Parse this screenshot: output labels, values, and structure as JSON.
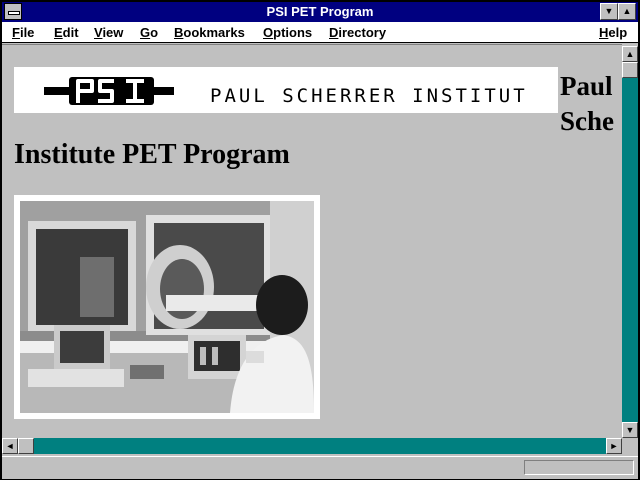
{
  "window": {
    "title": "PSI PET Program",
    "minimize_glyph": "▼",
    "maximize_glyph": "▲"
  },
  "menubar": {
    "items": [
      {
        "label": "File",
        "accel": "F",
        "rest": "ile"
      },
      {
        "label": "Edit",
        "accel": "E",
        "rest": "dit"
      },
      {
        "label": "View",
        "accel": "V",
        "rest": "iew"
      },
      {
        "label": "Go",
        "accel": "G",
        "rest": "o"
      },
      {
        "label": "Bookmarks",
        "accel": "B",
        "rest": "ookmarks"
      },
      {
        "label": "Options",
        "accel": "O",
        "rest": "ptions"
      },
      {
        "label": "Directory",
        "accel": "D",
        "rest": "irectory"
      },
      {
        "label": "Help",
        "accel": "H",
        "rest": "elp"
      }
    ]
  },
  "page": {
    "logo_wordmark": "PSI",
    "logo_text": "PAUL SCHERRER INSTITUT",
    "heading_right_line1": "Paul",
    "heading_right_line2": "Sche",
    "heading": "Institute PET Program"
  },
  "scrollbars": {
    "up_glyph": "▲",
    "down_glyph": "▼",
    "left_glyph": "◄",
    "right_glyph": "►"
  },
  "statusbar": {
    "text": ""
  },
  "colors": {
    "titlebar": "#000080",
    "window_bg": "#c0c0c0",
    "scroll_track": "#008080"
  }
}
